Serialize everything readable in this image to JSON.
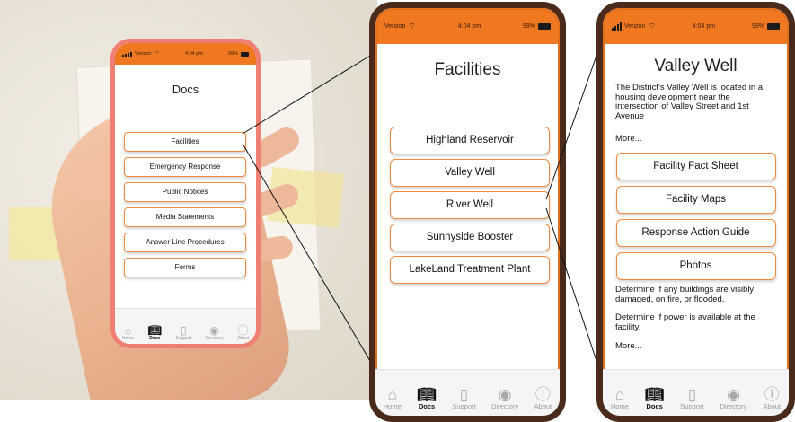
{
  "status": {
    "carrier": "Verizon",
    "time": "4:04 pm",
    "battery": "99%"
  },
  "tabs": [
    {
      "label": "Home",
      "icon": "home-icon"
    },
    {
      "label": "Docs",
      "icon": "book-icon"
    },
    {
      "label": "Support",
      "icon": "document-icon"
    },
    {
      "label": "Directory",
      "icon": "people-icon"
    },
    {
      "label": "About",
      "icon": "info-icon"
    }
  ],
  "docs": {
    "title": "Docs",
    "items": [
      "Facilities",
      "Emergency Response",
      "Public Notices",
      "Media Statements",
      "Answer Line Procedures",
      "Forms"
    ]
  },
  "facilities": {
    "title": "Facilities",
    "items": [
      "Highland Reservoir",
      "Valley Well",
      "River Well",
      "Sunnyside Booster",
      "LakeLand Treatment Plant"
    ]
  },
  "valley_well": {
    "title": "Valley Well",
    "description": "The District's Valley Well is located in a housing development near the intersection of Valley Street and 1st Avenue",
    "more_label": "More...",
    "buttons": [
      "Facility Fact Sheet",
      "Facility Maps",
      "Response Action Guide",
      "Photos"
    ],
    "note1": "Determine if any buildings are visibly damaged, on fire, or flooded.",
    "note2": "Determine if power is available at the facility.",
    "more_label_2": "More..."
  },
  "colors": {
    "accent": "#f07820",
    "button_border": "#f08a3c",
    "phone_frame": "#4a2a1a",
    "left_phone_case": "#ef7e73"
  }
}
